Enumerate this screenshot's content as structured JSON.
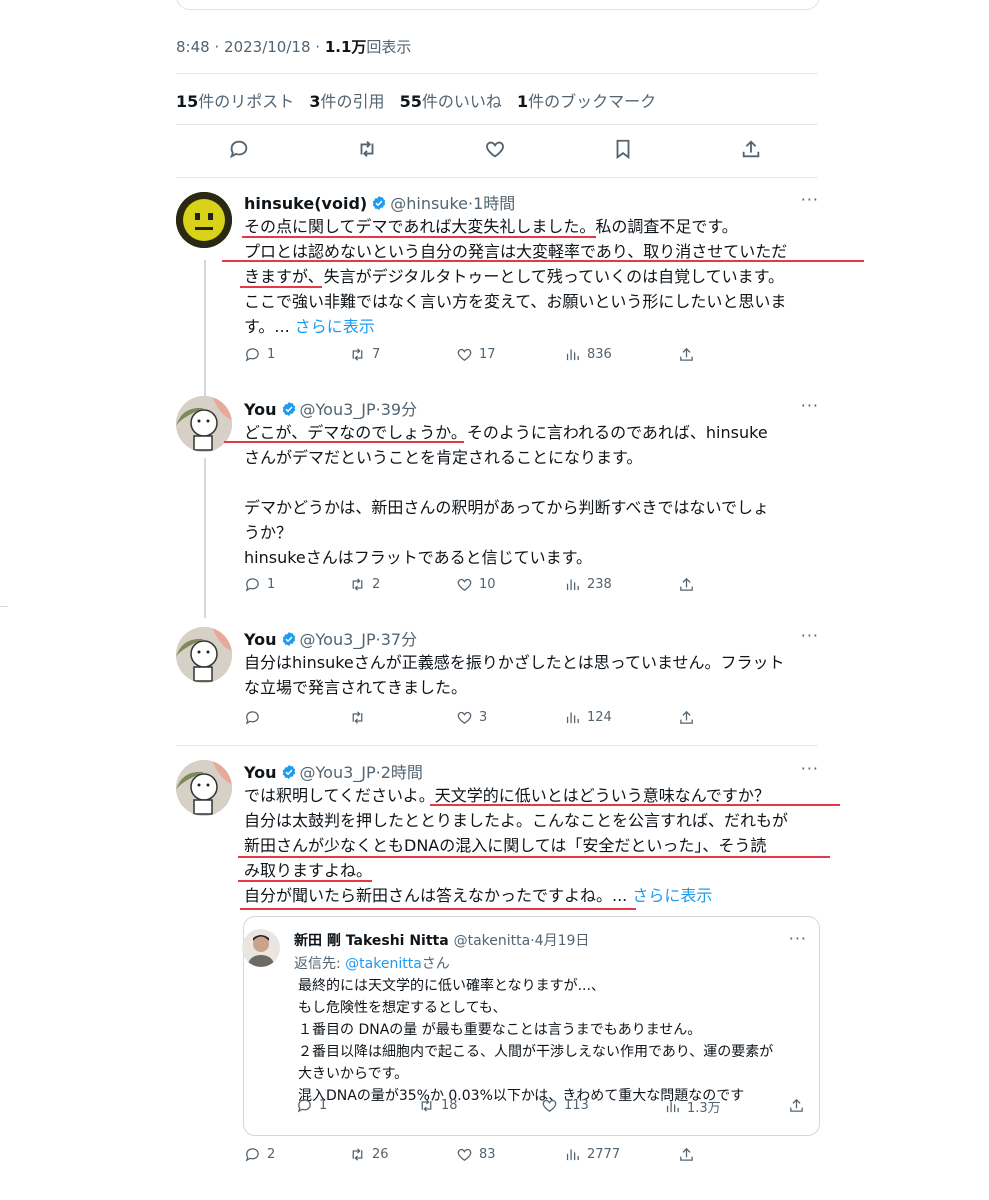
{
  "main_tweet": {
    "time": "8:48",
    "date": "2023/10/18",
    "views_num": "1.1万",
    "views_label": "回表示",
    "reposts_num": "15",
    "reposts_label": "件のリポスト",
    "quotes_num": "3",
    "quotes_label": "件の引用",
    "likes_num": "55",
    "likes_label": "件のいいね",
    "bookmarks_num": "1",
    "bookmarks_label": "件のブックマーク",
    "action_icons": [
      "reply-icon",
      "repost-icon",
      "like-icon",
      "bookmark-icon",
      "share-icon"
    ]
  },
  "replies": [
    {
      "name": "hinsuke(void)",
      "handle": "@hinsuke",
      "time": "1時間",
      "lines": [
        "その点に関してデマであれば大変失礼しました。私の調査不足です。",
        "プロとは認めないという自分の発言は大変軽率であり、取り消させていただ",
        "きますが、失言がデジタルタトゥーとして残っていくのは自覚しています。",
        "ここで強い非難ではなく言い方を変えて、お願いという形にしたいと思いま",
        "す。... "
      ],
      "more_link": "さらに表示",
      "replies": "1",
      "reposts": "7",
      "likes": "17",
      "views": "836"
    },
    {
      "name": "You",
      "handle": "@You3_JP",
      "time": "39分",
      "lines": [
        "どこが、デマなのでしょうか。そのように言われるのであれば、hinsuke",
        "さんがデマだということを肯定されることになります。",
        "",
        "デマかどうかは、新田さんの釈明があってから判断すべきではないでしょ",
        "うか？",
        "hinsukeさんはフラットであると信じています。"
      ],
      "replies": "1",
      "reposts": "2",
      "likes": "10",
      "views": "238"
    },
    {
      "name": "You",
      "handle": "@You3_JP",
      "time": "37分",
      "lines": [
        "自分はhinsukeさんが正義感を振りかざしたとは思っていません。フラット",
        "な立場で発言されてきました。"
      ],
      "replies": "",
      "reposts": "",
      "likes": "3",
      "views": "124"
    },
    {
      "name": "You",
      "handle": "@You3_JP",
      "time": "2時間",
      "lines": [
        "では釈明してくださいよ。天文学的に低いとはどういう意味なんですか？",
        "自分は太鼓判を押したととりましたよ。こんなことを公言すれば、だれもが",
        "新田さんが少なくともDNAの混入に関しては「安全だといった」、そう読",
        "み取りますよね。",
        "自分が聞いたら新田さんは答えなかったですよね。... "
      ],
      "more_link": "さらに表示",
      "replies": "2",
      "reposts": "26",
      "likes": "83",
      "views": "2777"
    }
  ],
  "quote": {
    "name": "新田 剛 Takeshi Nitta",
    "handle": "@takenitta",
    "date": "4月19日",
    "reply_to_prefix": "返信先: ",
    "reply_to_handle": "@takenitta",
    "reply_to_suffix": "さん",
    "lines": [
      "最終的には天文学的に低い確率となりますが...、",
      "もし危険性を想定するとしても、",
      "１番目の DNAの量 が最も重要なことは言うまでもありません。",
      "２番目以降は細胞内で起こる、人間が干渉しえない作用であり、運の要素が",
      "大きいからです。",
      "混入DNAの量が35%か 0.03%以下かは、きわめて重大な問題なのです"
    ],
    "replies": "1",
    "reposts": "18",
    "likes": "113",
    "views": "1.3万"
  },
  "more_icon_text": "···",
  "dot_sep": "·",
  "colors": {
    "link": "#1d9bf0",
    "annotation_underline": "#e53947",
    "verified": "#1d9bf0"
  }
}
